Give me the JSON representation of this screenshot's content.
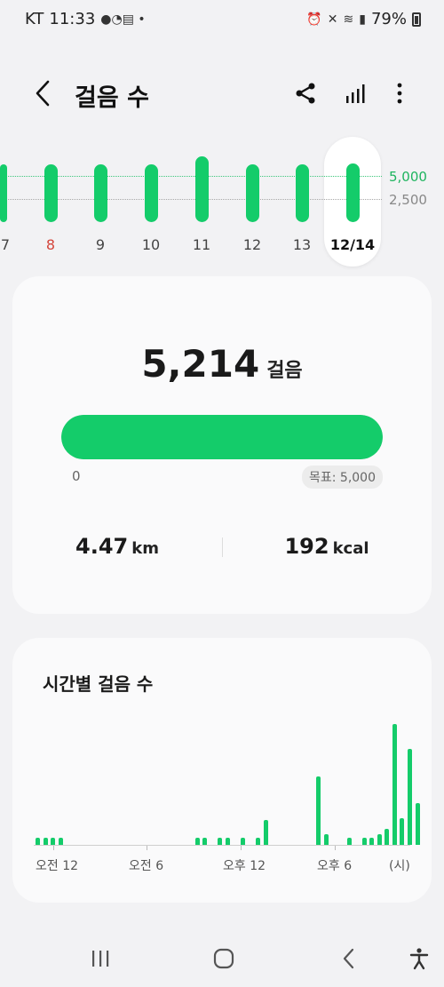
{
  "status_bar": {
    "carrier": "KT",
    "time": "11:33",
    "battery": "79%"
  },
  "header": {
    "title": "걸음 수",
    "back_icon": "chevron-left-icon",
    "share_icon": "share-icon",
    "stats_icon": "bar-chart-icon",
    "more_icon": "more-vertical-icon"
  },
  "weekly": {
    "goal_label": "5,000",
    "mid_label": "2,500",
    "days": [
      {
        "label": "7",
        "steps": 5100,
        "weekend": false
      },
      {
        "label": "8",
        "steps": 5100,
        "weekend": true
      },
      {
        "label": "9",
        "steps": 5100,
        "weekend": false
      },
      {
        "label": "10",
        "steps": 5100,
        "weekend": false
      },
      {
        "label": "11",
        "steps": 5800,
        "weekend": false
      },
      {
        "label": "12",
        "steps": 5100,
        "weekend": false
      },
      {
        "label": "13",
        "steps": 5100,
        "weekend": false
      },
      {
        "label": "12/14",
        "steps": 5214,
        "weekend": false,
        "selected": true
      }
    ]
  },
  "summary": {
    "steps": "5,214",
    "steps_unit": "걸음",
    "progress_fraction": 1.0,
    "progress_min": "0",
    "goal_text": "목표: 5,000",
    "distance_value": "4.47",
    "distance_unit": "km",
    "calories_value": "192",
    "calories_unit": "kcal"
  },
  "hourly": {
    "title": "시간별 걸음 수",
    "x_labels": [
      "오전 12",
      "오전 6",
      "오후 12",
      "오후 6",
      "(시)"
    ],
    "values": [
      8,
      8,
      8,
      8,
      0,
      0,
      0,
      0,
      0,
      0,
      0,
      0,
      0,
      0,
      0,
      0,
      0,
      0,
      0,
      0,
      0,
      8,
      8,
      0,
      8,
      8,
      0,
      8,
      0,
      8,
      28,
      0,
      0,
      0,
      0,
      0,
      0,
      78,
      12,
      0,
      0,
      8,
      0,
      8,
      8,
      12,
      18,
      138,
      30,
      110,
      48
    ],
    "y_max": 140
  },
  "nav": {
    "recents_icon": "recents-icon",
    "home_icon": "home-icon",
    "back_icon": "back-icon",
    "accessibility_icon": "accessibility-icon"
  }
}
